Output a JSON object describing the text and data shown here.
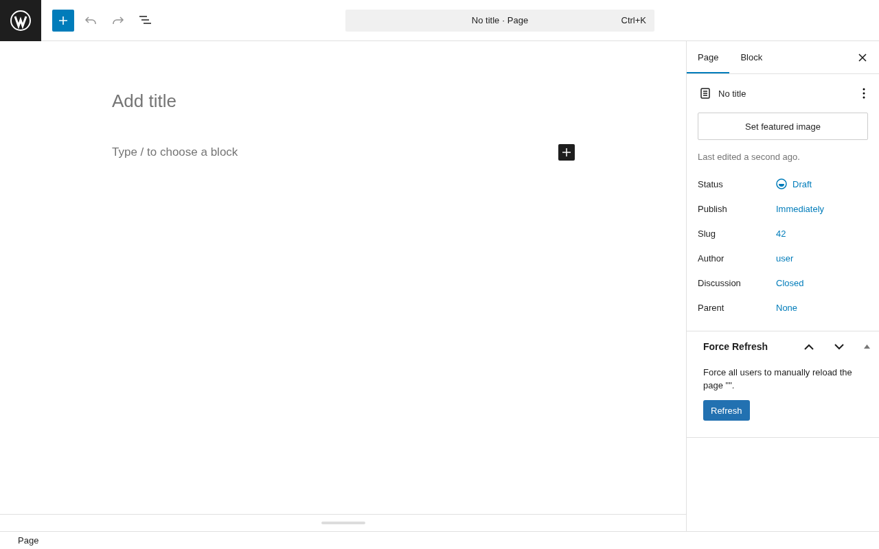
{
  "toolbar": {
    "undo": {
      "disabled": true
    },
    "redo": {
      "disabled": true
    }
  },
  "command_bar": {
    "title": "No title",
    "separator": "·",
    "type": "Page",
    "shortcut": "Ctrl+K"
  },
  "editor": {
    "title_placeholder": "Add title",
    "block_placeholder": "Type / to choose a block"
  },
  "sidebar": {
    "tabs": [
      {
        "label": "Page",
        "selected": true
      },
      {
        "label": "Block",
        "selected": false
      }
    ],
    "page_title": "No title",
    "featured_image_button": "Set featured image",
    "last_edited": "Last edited a second ago.",
    "fields": [
      {
        "label": "Status",
        "value": "Draft",
        "kind": "status"
      },
      {
        "label": "Publish",
        "value": "Immediately",
        "kind": "link"
      },
      {
        "label": "Slug",
        "value": "42",
        "kind": "link"
      },
      {
        "label": "Author",
        "value": "user",
        "kind": "link"
      },
      {
        "label": "Discussion",
        "value": "Closed",
        "kind": "link"
      },
      {
        "label": "Parent",
        "value": "None",
        "kind": "link"
      }
    ],
    "panel": {
      "title": "Force Refresh",
      "expanded": true,
      "text": "Force all users to manually reload the page \"\".",
      "button": "Refresh"
    }
  },
  "footer": {
    "breadcrumb": "Page"
  }
}
